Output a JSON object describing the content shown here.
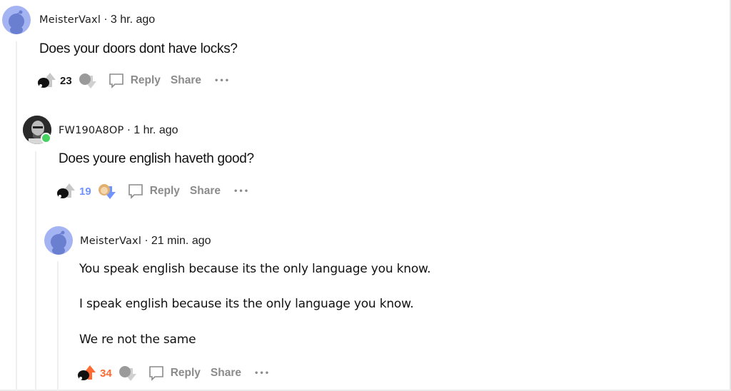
{
  "comments": [
    {
      "username": "MeisterVaxl",
      "separator": "·",
      "time": "3 hr. ago",
      "avatar": "snoo-avatar",
      "paragraphs": [
        "Does your doors dont have locks?"
      ],
      "votes": {
        "count": "23",
        "state": "neutral",
        "color": "#1c1c1c"
      },
      "actions": {
        "reply": "Reply",
        "share": "Share",
        "more": "•••"
      }
    },
    {
      "username": "FW190A8OP",
      "separator": "·",
      "time": "1 hr. ago",
      "avatar": "photo-avatar",
      "online": true,
      "paragraphs": [
        "Does youre english haveth good?"
      ],
      "votes": {
        "count": "19",
        "state": "downvoted",
        "color": "#7193ff"
      },
      "actions": {
        "reply": "Reply",
        "share": "Share",
        "more": "•••"
      }
    },
    {
      "username": "MeisterVaxl",
      "separator": "·",
      "time": "21 min. ago",
      "avatar": "snoo-avatar",
      "paragraphs": [
        "You speak english because its the only language you know.",
        "I speak english because its the only language you know.",
        "We re not the same"
      ],
      "votes": {
        "count": "34",
        "state": "upvoted",
        "color": "#ff6a33"
      },
      "actions": {
        "reply": "Reply",
        "share": "Share",
        "more": "•••"
      }
    }
  ],
  "colors": {
    "upvote": "#ff6a33",
    "downvote": "#7193ff",
    "neutral": "#c8c8c8",
    "online": "#46d160"
  }
}
